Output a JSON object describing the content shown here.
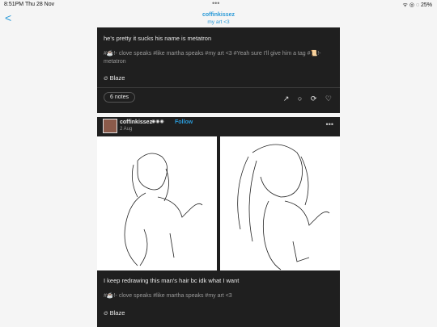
{
  "status": {
    "time": "8:51PM  Thu 28 Nov",
    "right": "ᯤ ◎ ◌ 25%"
  },
  "nav": {
    "back": "<",
    "title": "coffinkissez",
    "subtitle": "my art <3",
    "dots": "•••"
  },
  "post1": {
    "text": "he's pretty it sucks his name is metatron",
    "tags": "#☕!- clove speaks  #like martha speaks  #my art <3  #Yeah sure I'll give him a tag  #📜!- metatron",
    "blaze": "Blaze",
    "notes": "6 notes",
    "actions": {
      "share": "↗",
      "reply": "○",
      "reblog": "⟳",
      "like": "♡"
    }
  },
  "post2": {
    "username": "coffinkissez",
    "badges": "◉◉◉",
    "follow": "Follow",
    "date": "2 Aug",
    "more": "•••",
    "text": "I keep redrawing this man's hair bc idk what I want",
    "tags": "#☕!- clove speaks  #like martha speaks  #my art <3",
    "blaze": "Blaze"
  }
}
